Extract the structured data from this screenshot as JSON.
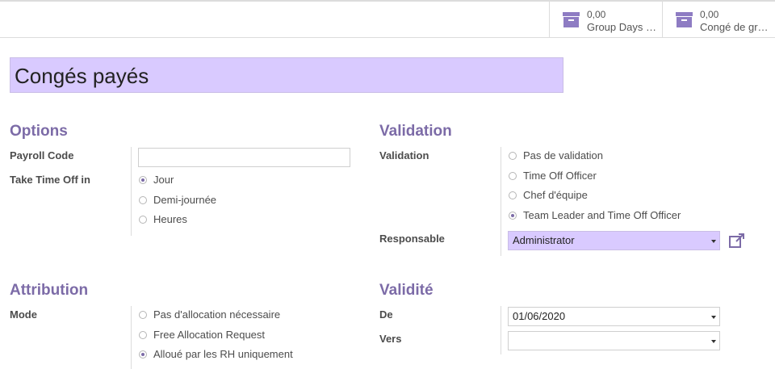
{
  "stat_buttons": [
    {
      "value": "0,00",
      "label": "Group Days …"
    },
    {
      "value": "0,00",
      "label": "Congé de gr…"
    }
  ],
  "title": "Congés payés",
  "options": {
    "heading": "Options",
    "payroll_code_label": "Payroll Code",
    "payroll_code_value": "",
    "take_time_off_label": "Take Time Off in",
    "take_time_off_choices": [
      "Jour",
      "Demi-journée",
      "Heures"
    ],
    "take_time_off_selected": 0
  },
  "validation": {
    "heading": "Validation",
    "validation_label": "Validation",
    "validation_choices": [
      "Pas de validation",
      "Time Off Officer",
      "Chef d'équipe",
      "Team Leader and Time Off Officer"
    ],
    "validation_selected": 3,
    "responsable_label": "Responsable",
    "responsable_value": "Administrator"
  },
  "attribution": {
    "heading": "Attribution",
    "mode_label": "Mode",
    "mode_choices": [
      "Pas d'allocation nécessaire",
      "Free Allocation Request",
      "Alloué par les RH uniquement"
    ],
    "mode_selected": 2
  },
  "validite": {
    "heading": "Validité",
    "from_label": "De",
    "from_value": "01/06/2020",
    "to_label": "Vers",
    "to_value": ""
  },
  "colors": {
    "accent": "#7c6ba7",
    "highlight": "#d9caff"
  },
  "icons": {
    "stat": "archive-box-icon",
    "external": "external-link-icon"
  }
}
